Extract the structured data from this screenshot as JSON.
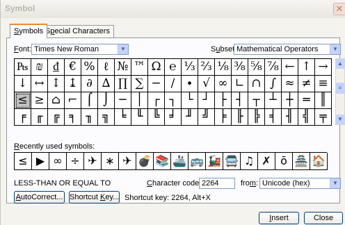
{
  "window": {
    "title": "Symbol",
    "close_glyph": "✕"
  },
  "tabs": [
    {
      "pre": "",
      "ul": "S",
      "post": "ymbols"
    },
    {
      "pre": "S",
      "ul": "p",
      "post": "ecial Characters"
    }
  ],
  "font": {
    "pre": "",
    "ul": "F",
    "post": "ont:",
    "value": "Times New Roman"
  },
  "subset": {
    "pre": "S",
    "ul": "u",
    "post": "bset:",
    "value": "Mathematical Operators"
  },
  "grid_rows": [
    [
      "₧",
      "₪",
      "₫",
      "€",
      "%",
      "ℓ",
      "№",
      "™",
      "Ω",
      "℮",
      "⅓",
      "⅔",
      "⅛",
      "⅜",
      "⅝",
      "⅞",
      "←",
      "↑",
      "→"
    ],
    [
      "↓",
      "↔",
      "↕",
      "↨",
      "∂",
      "∆",
      "∏",
      "∑",
      "−",
      "∕",
      "∙",
      "√",
      "∞",
      "∟",
      "∩",
      "∫",
      "≈",
      "≠",
      "≡"
    ],
    [
      "≤",
      "≥",
      "⌂",
      "⌐",
      "⌠",
      "⌡",
      "─",
      "│",
      "┌",
      "┐",
      "└",
      "┘",
      "├",
      "┤",
      "┬",
      "┴",
      "┼",
      "═",
      "║"
    ],
    [
      "╒",
      "╓",
      "╔",
      "╕",
      "╖",
      "╗",
      "╘",
      "╙",
      "╚",
      "╛",
      "╜",
      "╝",
      "╞",
      "╟",
      "╠",
      "╡",
      "╢",
      "╣",
      "╤"
    ]
  ],
  "recent": {
    "pre": "",
    "ul": "R",
    "post": "ecently used symbols:",
    "symbols": [
      "≤",
      "▶",
      "∞",
      "÷",
      "✈",
      "∗",
      "✈",
      "💣",
      "📚",
      "🚢",
      "🚌",
      "🚂",
      "🚍",
      "♫",
      "✗",
      "ō",
      "🏯",
      "🏠"
    ]
  },
  "char_name": "LESS-THAN OR EQUAL TO",
  "char_code": {
    "pre": "",
    "ul": "C",
    "post": "haracter code:",
    "value": "2264"
  },
  "from": {
    "pre": "fro",
    "ul": "m",
    "post": ":",
    "value": "Unicode (hex)"
  },
  "buttons": {
    "autocorrect": {
      "pre": "",
      "ul": "A",
      "post": "utoCorrect..."
    },
    "shortcut_key": {
      "pre": "Shortcut ",
      "ul": "K",
      "post": "ey..."
    },
    "insert": {
      "pre": "",
      "ul": "I",
      "post": "nsert"
    },
    "close": "Close"
  },
  "shortcut_text": "Shortcut key: 2264, Alt+X",
  "icons": {
    "dropdown": "▼",
    "scroll_up": "▲",
    "scroll_down": "▼",
    "scroll_grip": "≡"
  }
}
